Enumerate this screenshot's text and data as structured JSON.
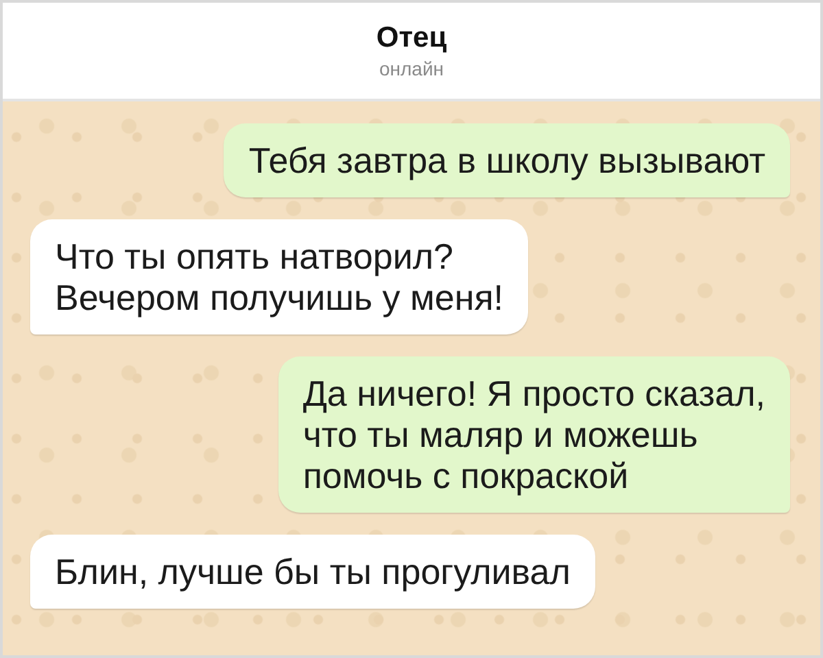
{
  "header": {
    "name": "Отец",
    "status": "онлайн"
  },
  "messages": [
    {
      "kind": "outgoing",
      "text": "Тебя завтра в школу вызывают"
    },
    {
      "kind": "incoming",
      "text": "Что ты опять натворил?\nВечером получишь у меня!"
    },
    {
      "kind": "outgoing",
      "text": "Да ничего! Я просто сказал,\nчто ты маляр и можешь\nпомочь с покраской"
    },
    {
      "kind": "incoming",
      "text": "Блин, лучше бы ты прогуливал"
    }
  ]
}
